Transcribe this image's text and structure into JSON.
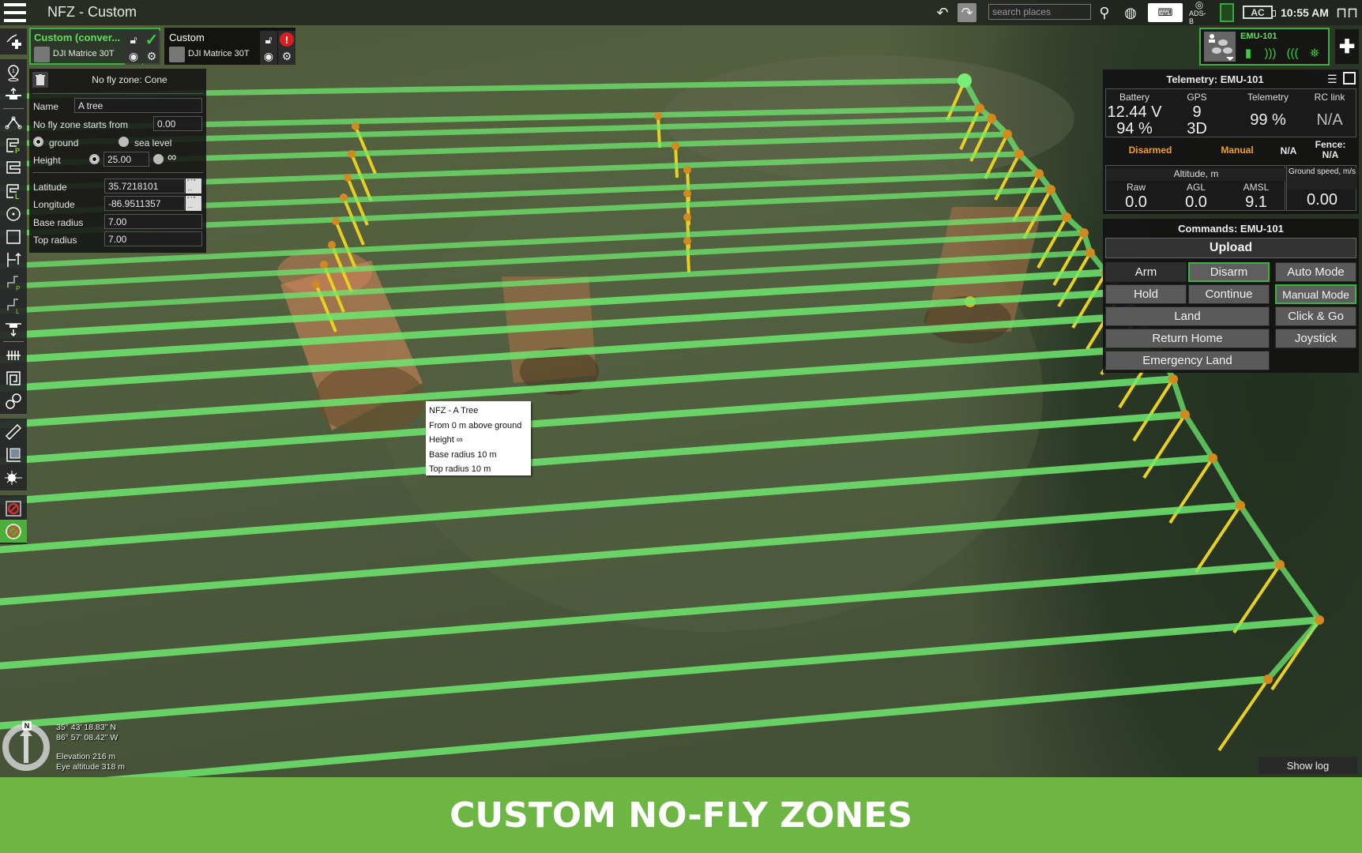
{
  "app": {
    "title": "NFZ - Custom"
  },
  "topbar": {
    "search_placeholder": "search places",
    "adsb_label": "ADS-B",
    "power_label": "AC",
    "clock": "10:55 AM",
    "icons": [
      "menu-icon",
      "undo-icon",
      "redo-icon",
      "search-icon",
      "globe-icon",
      "keyboard-icon",
      "adsb-icon",
      "document-icon",
      "power-icon",
      "connections-icon"
    ]
  },
  "missions": [
    {
      "name": "Custom (conver...",
      "drone": "DJI Matrice 30T",
      "status": "ok",
      "active": true
    },
    {
      "name": "Custom",
      "drone": "DJI Matrice 30T",
      "status": "error",
      "active": false
    }
  ],
  "left_toolbar": {
    "groups": [
      [
        "route-add"
      ],
      [
        "waypoint",
        "takeoff",
        "polyline",
        "scan-photo",
        "scan-area",
        "scan-line",
        "circle-orbit",
        "rectangle",
        "facade-scan",
        "corridor-photo",
        "corridor-line",
        "landing",
        "vertical-scan",
        "spiral",
        "double-orbit"
      ],
      [
        "ruler",
        "area-measure",
        "laser-point"
      ],
      [
        "no-fly-zone-polygon",
        "no-fly-zone-cone"
      ]
    ],
    "active": "no-fly-zone-cone"
  },
  "nfz_panel": {
    "title": "No fly zone: Cone",
    "name_label": "Name",
    "name_value": "A tree",
    "starts_label": "No fly zone starts from",
    "starts_value": "0.00",
    "ref_options": [
      "ground",
      "sea level"
    ],
    "ref_selected": "ground",
    "height_label": "Height",
    "height_value": "25.00",
    "height_infinite_symbol": "∞",
    "height_mode": "value",
    "latitude_label": "Latitude",
    "latitude_value": "35.7218101",
    "longitude_label": "Longitude",
    "longitude_value": "-86.9511357",
    "base_radius_label": "Base radius",
    "base_radius_value": "7.00",
    "top_radius_label": "Top radius",
    "top_radius_value": "7.00",
    "format_label_dms": "° ′ ″",
    "format_label_dec": "…"
  },
  "drone_widget": {
    "name": "EMU-101",
    "status_icons": [
      "battery-icon",
      "telemetry-signal-icon",
      "rc-signal-icon",
      "gps-satellite-icon"
    ],
    "accent": "#3cb043"
  },
  "telemetry": {
    "title": "Telemetry: EMU-101",
    "battery_label": "Battery",
    "battery_voltage": "12.44 V",
    "battery_percent": "94 %",
    "gps_label": "GPS",
    "gps_sats": "9",
    "gps_fix": "3D",
    "telemetry_label": "Telemetry",
    "telemetry_value": "99 %",
    "rc_label": "RC link",
    "rc_value": "N/A",
    "arm_state": "Disarmed",
    "flight_mode": "Manual",
    "extra_state": "N/A",
    "fence_label": "Fence:",
    "fence_value": "N/A",
    "altitude_label": "Altitude, m",
    "raw_label": "Raw",
    "raw_value": "0.0",
    "agl_label": "AGL",
    "agl_value": "0.0",
    "amsl_label": "AMSL",
    "amsl_value": "9.1",
    "speed_label": "Ground speed, m/s",
    "speed_value": "0.00",
    "status_color": "#f0a020"
  },
  "commands": {
    "title": "Commands: EMU-101",
    "upload": "Upload",
    "arm": "Arm",
    "disarm": "Disarm",
    "auto_mode": "Auto Mode",
    "hold": "Hold",
    "continue": "Continue",
    "manual_mode": "Manual Mode",
    "land": "Land",
    "click_go": "Click & Go",
    "return_home": "Return Home",
    "joystick": "Joystick",
    "emergency_land": "Emergency Land"
  },
  "tooltip": {
    "lines": [
      "NFZ - A Tree",
      "From 0 m above ground",
      "Height ∞",
      "Base radius 10 m",
      "Top radius 10 m"
    ]
  },
  "map_info": {
    "lat": "35° 43' 18.83\" N",
    "lon": "86° 57' 08.42\" W",
    "elevation": "Elevation 216 m",
    "eye_altitude": "Eye altitude 318 m",
    "compass_north": "N"
  },
  "show_log": "Show log",
  "banner": {
    "text": "CUSTOM NO-FLY ZONES",
    "color": "#6db643"
  }
}
